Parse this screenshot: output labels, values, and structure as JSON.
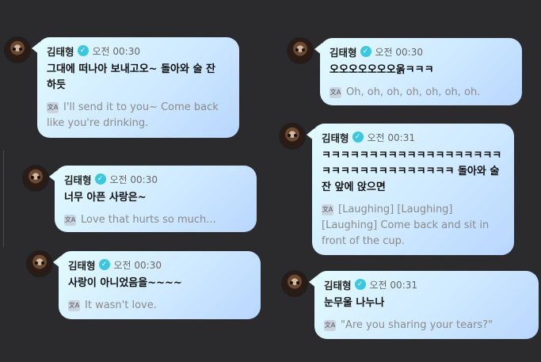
{
  "messages": [
    {
      "sender": "김태형",
      "time": "오전 00:30",
      "text": "그대에 떠나아 보내고오~ 돌아와 술 잔 하듯",
      "translation": "I'll send it to you~ Come back like you're drinking."
    },
    {
      "sender": "김태형",
      "time": "오전 00:30",
      "text": "너무 아픈 사랑은~",
      "translation": "Love that hurts so much..."
    },
    {
      "sender": "김태형",
      "time": "오전 00:30",
      "text": "사랑이 아니었음을~~~~",
      "translation": "It wasn't love."
    },
    {
      "sender": "김태형",
      "time": "오전 00:30",
      "text": "오오오오오오오옭ㅋㅋㅋ",
      "translation": "Oh, oh, oh, oh, oh, oh, oh."
    },
    {
      "sender": "김태형",
      "time": "오전 00:31",
      "text": "ㅋㅋㅋㅋㅋㅋㅋㅋㅋㅋㅋㅋㅋㅋㅋㅋㅋㅋㅋㅋㅋㅋㅋㅋㅋㅋㅋㅋㅋㅋㅋㅋㅋ 돌아와 술잔 앞에 앉으면",
      "translation": "[Laughing] [Laughing] [Laughing] Come back and sit in front of the cup."
    },
    {
      "sender": "김태형",
      "time": "오전 00:31",
      "text": "눈무울 나누나",
      "translation": "\"Are you sharing your tears?\""
    }
  ],
  "icons": {
    "verified": "verified-check-icon",
    "translate": "translate-icon"
  },
  "colors": {
    "background": "#2b2b2d",
    "bubble_start": "#e2fbff",
    "bubble_end": "#b8d6ff",
    "verified": "#3cc7e0"
  }
}
